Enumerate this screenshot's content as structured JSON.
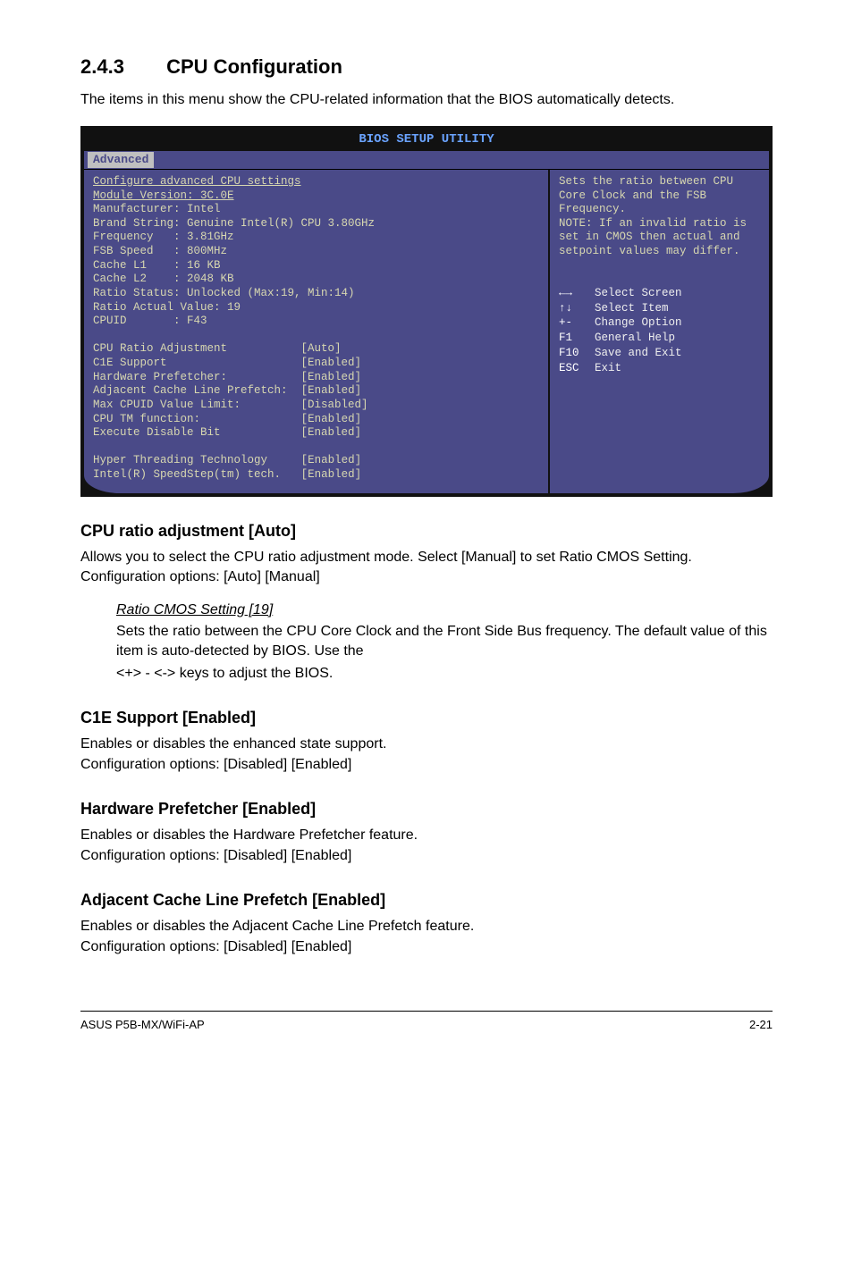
{
  "section": {
    "number": "2.4.3",
    "title": "CPU Configuration"
  },
  "intro": "The items in this menu show the CPU-related information that the BIOS automatically detects.",
  "bios": {
    "title": "BIOS SETUP UTILITY",
    "tab": "Advanced",
    "left": {
      "header1": "Configure advanced CPU settings",
      "header2": "Module Version: 3C.0E",
      "info": [
        "Manufacturer: Intel",
        "Brand String: Genuine Intel(R) CPU 3.80GHz",
        "Frequency   : 3.81GHz",
        "FSB Speed   : 800MHz",
        "Cache L1    : 16 KB",
        "Cache L2    : 2048 KB",
        "Ratio Status: Unlocked (Max:19, Min:14)",
        "Ratio Actual Value: 19",
        "CPUID       : F43"
      ],
      "settings": [
        {
          "label": "CPU Ratio Adjustment",
          "value": "[Auto]"
        },
        {
          "label": "C1E Support",
          "value": "[Enabled]"
        },
        {
          "label": "Hardware Prefetcher:",
          "value": "[Enabled]"
        },
        {
          "label": "Adjacent Cache Line Prefetch:",
          "value": "[Enabled]"
        },
        {
          "label": "Max CPUID Value Limit:",
          "value": "[Disabled]"
        },
        {
          "label": "CPU TM function:",
          "value": "[Enabled]"
        },
        {
          "label": "Execute Disable Bit",
          "value": "[Enabled]"
        }
      ],
      "settings2": [
        {
          "label": "Hyper Threading Technology",
          "value": "[Enabled]"
        },
        {
          "label": "Intel(R) SpeedStep(tm) tech.",
          "value": "[Enabled]"
        }
      ]
    },
    "right": {
      "help": "Sets the ratio between CPU Core Clock and the FSB Frequency.\nNOTE: If an invalid ratio is set in CMOS then actual and setpoint values may differ.",
      "keys": [
        {
          "k": "←→",
          "d": "Select Screen"
        },
        {
          "k": "↑↓",
          "d": "Select Item"
        },
        {
          "k": "+-",
          "d": "Change Option"
        },
        {
          "k": "F1",
          "d": "General Help"
        },
        {
          "k": "F10",
          "d": "Save and Exit"
        },
        {
          "k": "ESC",
          "d": "Exit"
        }
      ]
    }
  },
  "items": {
    "cpu_ratio": {
      "h": "CPU ratio adjustment [Auto]",
      "p": "Allows you to select the CPU ratio adjustment mode. Select [Manual] to set Ratio CMOS Setting. Configuration options: [Auto] [Manual]",
      "sub_h": "Ratio CMOS Setting [19]",
      "sub_p1": "Sets the ratio between the CPU Core Clock and the Front Side Bus frequency. The default value of this item is auto-detected by BIOS. Use the",
      "sub_p2": "<+> - <-> keys to adjust the BIOS."
    },
    "c1e": {
      "h": "C1E Support [Enabled]",
      "p1": "Enables or disables the enhanced state support.",
      "p2": "Configuration options: [Disabled] [Enabled]"
    },
    "hw_pref": {
      "h": "Hardware Prefetcher [Enabled]",
      "p1": "Enables or disables the Hardware Prefetcher feature.",
      "p2": "Configuration options: [Disabled] [Enabled]"
    },
    "adj_cache": {
      "h": "Adjacent Cache Line Prefetch [Enabled]",
      "p1": "Enables or disables the Adjacent Cache Line Prefetch feature.",
      "p2": "Configuration options: [Disabled] [Enabled]"
    }
  },
  "footer": {
    "left": "ASUS P5B-MX/WiFi-AP",
    "right": "2-21"
  }
}
